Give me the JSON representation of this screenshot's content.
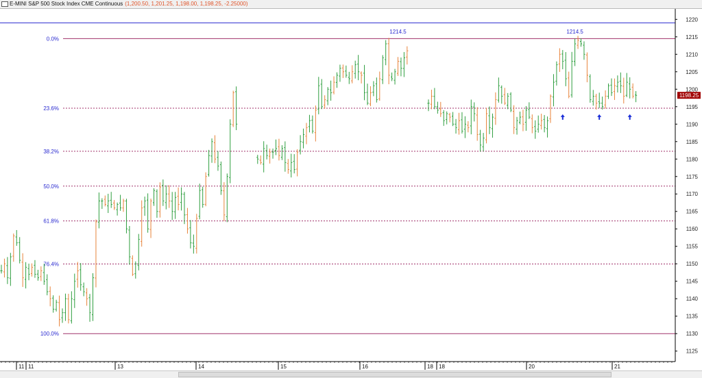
{
  "window": {
    "title": "E-MINI S&P 500 Stock Index CME Continuous",
    "quote": "(1,200.50, 1,201.25, 1,198.00, 1,198.25, -2.25000)"
  },
  "colors": {
    "background": "#ffffff",
    "bar": "#2e9e3e",
    "bar_alt": "#e8833a",
    "fib_line": "#a0306a",
    "fib_label": "#2a2ad0",
    "top_line": "#2a2ad0",
    "price_tag_bg": "#a00000",
    "price_tag_fg": "#ffffff",
    "arrow": "#1a2ed8"
  },
  "icons": [
    "window-icon",
    "up-arrow-icon"
  ],
  "chart_data": {
    "type": "bar",
    "subtype": "ohlc-price-chart",
    "instrument": "E-MINI S&P 500 Stock Index CME Continuous",
    "ylim": [
      1122,
      1223
    ],
    "y_ticks": [
      1125,
      1130,
      1135,
      1140,
      1145,
      1150,
      1155,
      1160,
      1165,
      1170,
      1175,
      1180,
      1185,
      1190,
      1195,
      1200,
      1205,
      1210,
      1215,
      1220
    ],
    "y_axis_position": "right",
    "x_ticks": [
      "11",
      "11",
      "13",
      "14",
      "15",
      "16",
      "18",
      "18",
      "20",
      "21"
    ],
    "grid": false,
    "current_price_label": "1198.25",
    "fibonacci": {
      "high": 1214.5,
      "low": 1130,
      "levels": [
        {
          "label": "0.0%",
          "ratio": 0.0
        },
        {
          "label": "23.6%",
          "ratio": 0.236
        },
        {
          "label": "38.2%",
          "ratio": 0.382
        },
        {
          "label": "50.0%",
          "ratio": 0.5
        },
        {
          "label": "61.8%",
          "ratio": 0.618
        },
        {
          "label": "76.4%",
          "ratio": 0.764
        },
        {
          "label": "100.0%",
          "ratio": 1.0
        }
      ]
    },
    "top_line_price": 1219,
    "annotations": [
      {
        "text": "1214.5",
        "bar_index": 130,
        "price": 1215.5
      },
      {
        "text": "1214.5",
        "bar_index": 188,
        "price": 1215.5
      }
    ],
    "support_arrows": [
      {
        "bar_index": 184,
        "price": 1193.4
      },
      {
        "bar_index": 196,
        "price": 1193.4
      },
      {
        "bar_index": 206,
        "price": 1193.4
      }
    ],
    "segments": [
      {
        "start_index": 0,
        "closes": [
          1148,
          1150,
          1146,
          1152,
          1158,
          1156,
          1151,
          1146,
          1149,
          1147,
          1149,
          1147,
          1146,
          1148,
          1145,
          1142,
          1140,
          1137,
          1139,
          1134,
          1136,
          1140,
          1134,
          1140,
          1145,
          1148,
          1144,
          1142,
          1140,
          1136,
          1146,
          1162,
          1168,
          1168,
          1167,
          1168,
          1167,
          1166,
          1167,
          1166,
          1168,
          1160,
          1152,
          1147,
          1150,
          1157,
          1166,
          1168,
          1160,
          1168,
          1171,
          1165,
          1172,
          1168,
          1170,
          1168,
          1165,
          1169,
          1167,
          1170,
          1164,
          1160,
          1156,
          1155,
          1163,
          1171,
          1167,
          1175,
          1181,
          1185,
          1180,
          1178,
          1171,
          1164,
          1175,
          1190,
          1199,
          1190
        ]
      },
      {
        "start_index": 84,
        "closes": [
          1180,
          1179,
          1183,
          1181,
          1182,
          1182,
          1183,
          1181,
          1183,
          1179,
          1177,
          1179,
          1177,
          1182,
          1185,
          1187,
          1189,
          1191,
          1188,
          1194,
          1201,
          1195,
          1197,
          1200,
          1199,
          1202,
          1204,
          1206,
          1205,
          1204,
          1203,
          1205,
          1207,
          1205,
          1204,
          1199,
          1196,
          1199,
          1201,
          1197,
          1203,
          1209,
          1213,
          1204,
          1203,
          1205,
          1208,
          1206,
          1209,
          1211
        ]
      },
      {
        "start_index": 140,
        "closes": [
          1196,
          1198,
          1195,
          1194,
          1193,
          1191,
          1193,
          1192,
          1190,
          1189,
          1191,
          1188,
          1190,
          1189,
          1195,
          1193,
          1187,
          1184,
          1186,
          1193,
          1189,
          1192,
          1197,
          1201,
          1198,
          1196,
          1198,
          1194,
          1189,
          1191,
          1192,
          1190,
          1194,
          1192,
          1189,
          1188,
          1190,
          1191,
          1189,
          1191,
          1198,
          1202,
          1207,
          1210,
          1208,
          1203,
          1198,
          1208,
          1213,
          1214,
          1213,
          1210,
          1204,
          1197,
          1198,
          1196,
          1196,
          1195,
          1198,
          1201,
          1199,
          1201,
          1202,
          1201,
          1198,
          1202,
          1200,
          1198,
          1198.25
        ]
      }
    ]
  }
}
